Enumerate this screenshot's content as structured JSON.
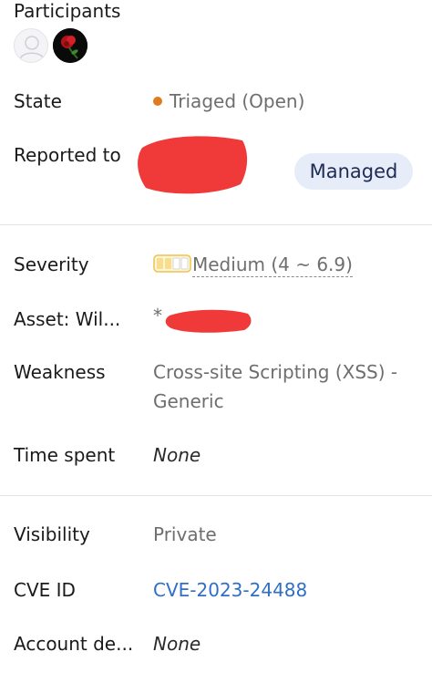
{
  "participants": {
    "label": "Participants",
    "avatars": [
      {
        "icon": "default-user-avatar"
      },
      {
        "icon": "rose-avatar"
      }
    ]
  },
  "state": {
    "label": "State",
    "value": "Triaged (Open)",
    "dot_color": "#e07b20"
  },
  "reported_to": {
    "label": "Reported to",
    "badge": "Managed"
  },
  "severity": {
    "label": "Severity",
    "value": "Medium (4 ~ 6.9)",
    "level_filled": 2,
    "level_total": 4,
    "color": "#f5c242"
  },
  "asset": {
    "label": "Asset: Wil...",
    "prefix": "*"
  },
  "weakness": {
    "label": "Weakness",
    "line1": "Cross-site Scripting (XSS) -",
    "line2": "Generic"
  },
  "time_spent": {
    "label": "Time spent",
    "value": "None"
  },
  "visibility": {
    "label": "Visibility",
    "value": "Private"
  },
  "cve": {
    "label": "CVE ID",
    "value": "CVE-2023-24488"
  },
  "account": {
    "label": "Account de...",
    "value": "None"
  }
}
